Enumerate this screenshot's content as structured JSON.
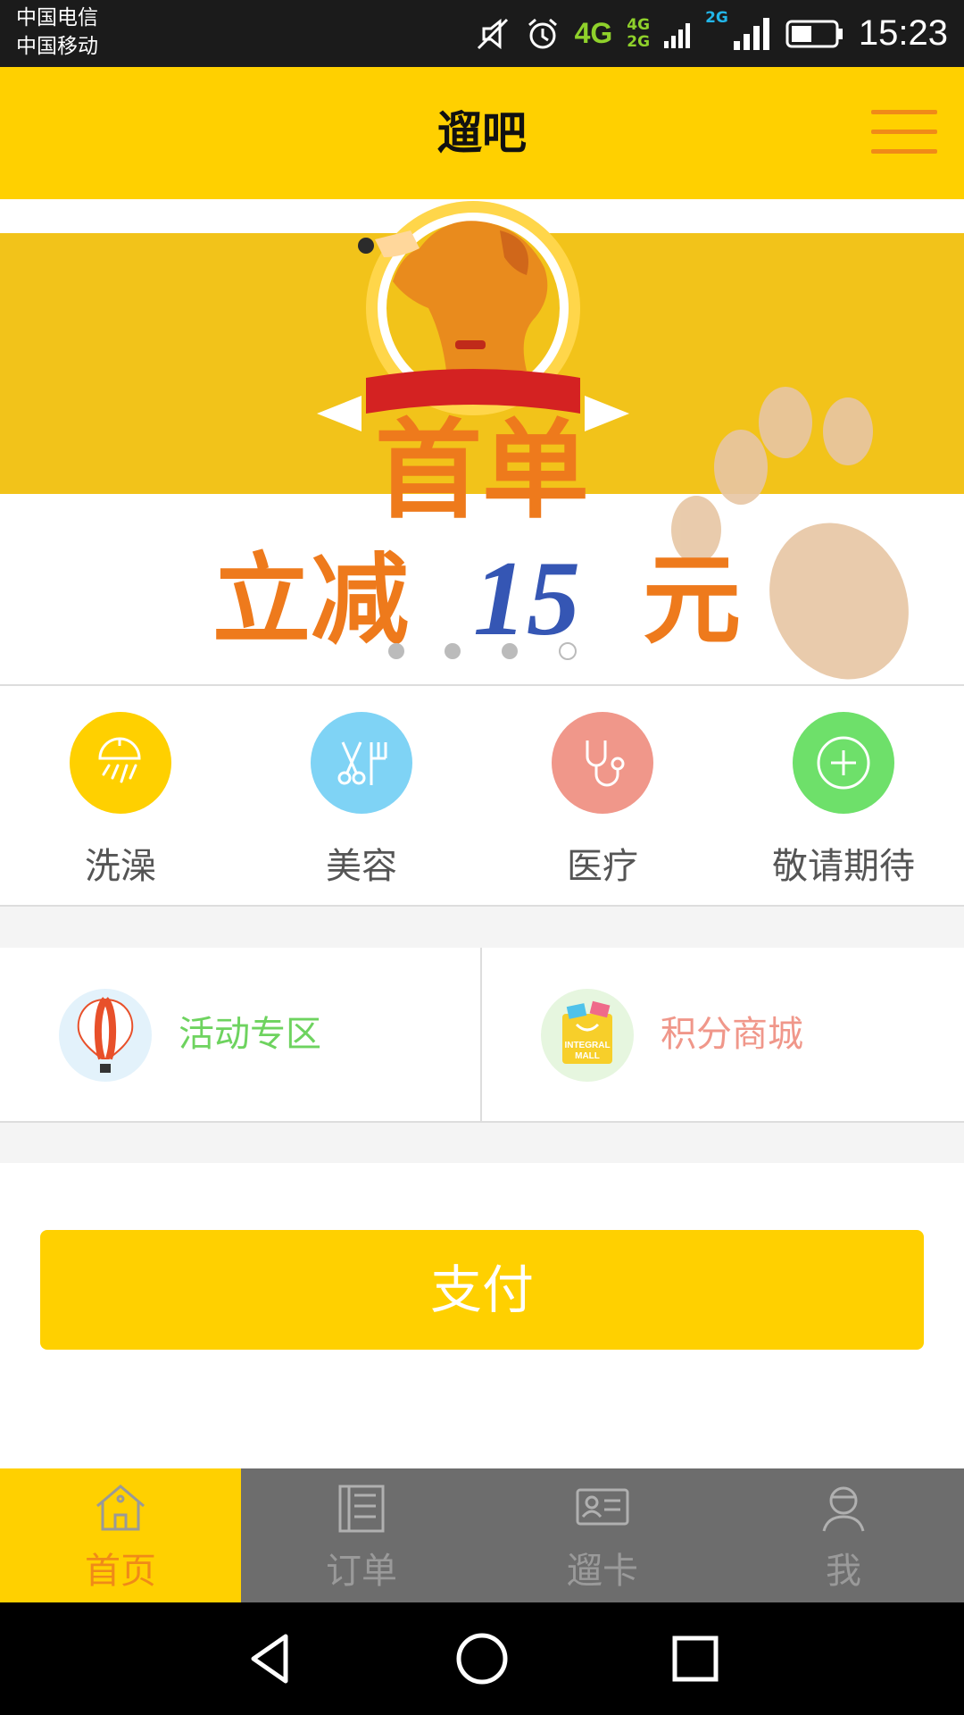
{
  "status_bar": {
    "carrier_1": "中国电信",
    "carrier_2": "中国移动",
    "network_main": "4G",
    "network_small_top": "4G",
    "network_small_bottom": "2G",
    "network_second": "2G",
    "time": "15:23",
    "icons": [
      "mute-icon",
      "alarm-icon",
      "signal-icon",
      "battery-icon"
    ]
  },
  "header": {
    "title": "遛吧",
    "menu_icon": "hamburger-menu-icon"
  },
  "banner": {
    "line1": "首单",
    "line2_prefix": "立减",
    "amount": "15",
    "line2_suffix": "元",
    "slides": 4,
    "active_slide": 4
  },
  "categories": [
    {
      "label": "洗澡",
      "icon": "shower-icon",
      "color": "#ffd000"
    },
    {
      "label": "美容",
      "icon": "scissors-comb-icon",
      "color": "#7fd3f5"
    },
    {
      "label": "医疗",
      "icon": "stethoscope-icon",
      "color": "#f0978a"
    },
    {
      "label": "敬请期待",
      "icon": "plus-circle-icon",
      "color": "#6ee06a"
    }
  ],
  "promos": [
    {
      "label": "活动专区",
      "icon": "balloon-icon",
      "color": "#6ed35f"
    },
    {
      "label": "积分商城",
      "icon": "integral-mall-icon",
      "color": "#f0978a",
      "icon_text_1": "INTEGRAL",
      "icon_text_2": "MALL"
    }
  ],
  "pay": {
    "label": "支付"
  },
  "bottom_nav": [
    {
      "label": "首页",
      "icon": "home-icon",
      "active": true
    },
    {
      "label": "订单",
      "icon": "order-list-icon",
      "active": false
    },
    {
      "label": "遛卡",
      "icon": "card-icon",
      "active": false
    },
    {
      "label": "我",
      "icon": "user-icon",
      "active": false
    }
  ],
  "system_nav": [
    "back-icon",
    "home-circle-icon",
    "recents-icon"
  ],
  "colors": {
    "brand": "#ffd000",
    "accent_orange": "#f08a18",
    "nav_gray": "#6d6d6d"
  }
}
